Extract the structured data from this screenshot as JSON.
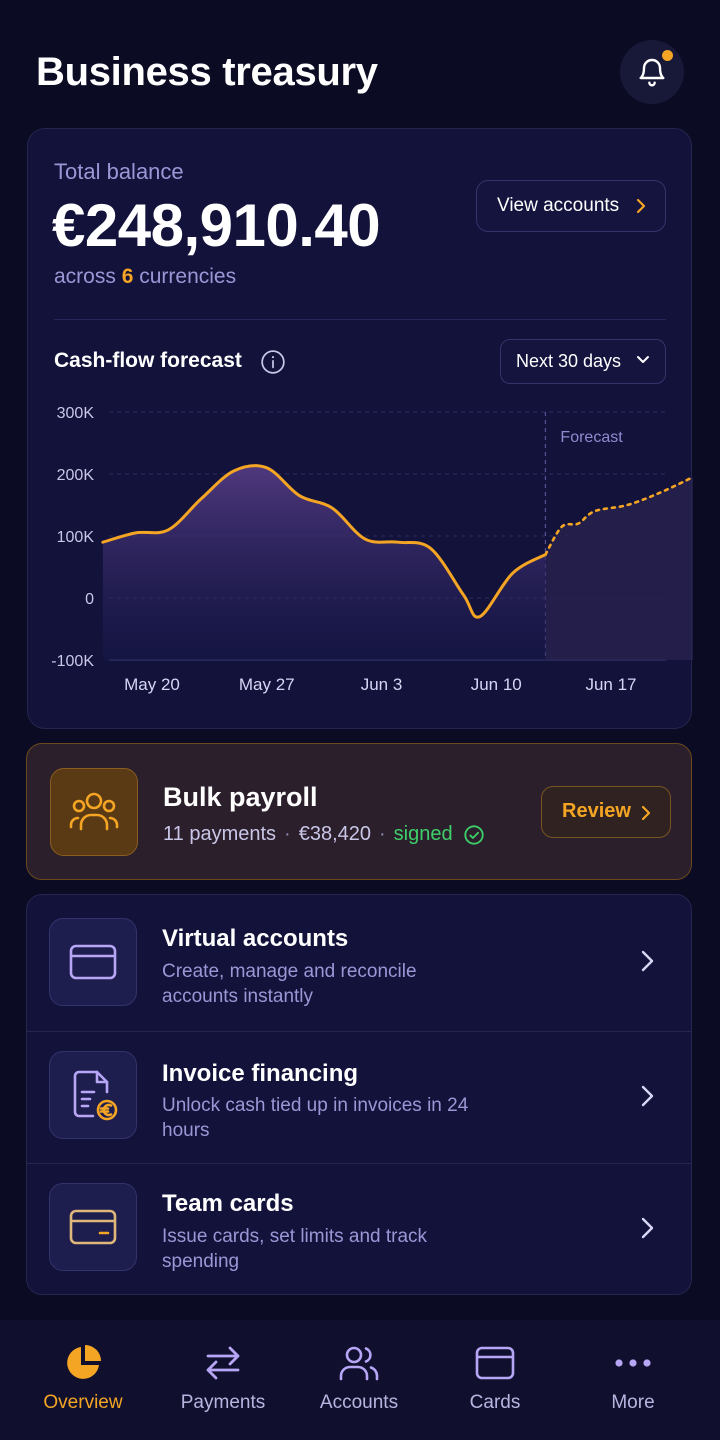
{
  "header": {
    "title": "Business treasury"
  },
  "balance": {
    "label": "Total balance",
    "amount": "€248,910.40",
    "sub_prefix": "across",
    "currency_count": "6",
    "sub_suffix": "currencies",
    "view_accounts_label": "View accounts"
  },
  "forecast": {
    "title": "Cash-flow forecast",
    "range_label": "Next 30 days"
  },
  "chart_data": {
    "type": "line",
    "xlabel": "",
    "ylabel": "",
    "ylim": [
      -100000,
      300000
    ],
    "y_ticks": [
      "300K",
      "200K",
      "100K",
      "0",
      "-100K"
    ],
    "x_ticks": [
      "May 20",
      "May 27",
      "Jun 3",
      "Jun 10",
      "Jun 17"
    ],
    "forecast_label": "Forecast",
    "forecast_start": "Jun 13",
    "grid": true,
    "series": [
      {
        "name": "",
        "points": [
          [
            "May 17",
            90000
          ],
          [
            "May 19",
            105000
          ],
          [
            "May 21",
            110000
          ],
          [
            "May 23",
            160000
          ],
          [
            "May 25",
            205000
          ],
          [
            "May 27",
            210000
          ],
          [
            "May 29",
            165000
          ],
          [
            "May 31",
            145000
          ],
          [
            "Jun 2",
            95000
          ],
          [
            "Jun 4",
            90000
          ],
          [
            "Jun 6",
            80000
          ],
          [
            "Jun 8",
            5000
          ],
          [
            "Jun 9",
            -30000
          ],
          [
            "Jun 11",
            40000
          ],
          [
            "Jun 13",
            70000
          ],
          [
            "Jun 14",
            115000
          ],
          [
            "Jun 15",
            120000
          ],
          [
            "Jun 16",
            140000
          ],
          [
            "Jun 18",
            150000
          ],
          [
            "Jun 20",
            170000
          ],
          [
            "Jun 22",
            195000
          ]
        ]
      }
    ]
  },
  "payroll": {
    "title": "Bulk payroll",
    "payments": "11 payments",
    "amount": "€38,420",
    "status": "signed",
    "review_label": "Review"
  },
  "services": [
    {
      "title": "Virtual accounts",
      "desc": "Create, manage and reconcile accounts instantly"
    },
    {
      "title": "Invoice financing",
      "desc": "Unlock cash tied up in invoices in 24 hours"
    },
    {
      "title": "Team cards",
      "desc": "Issue cards, set limits and track spending"
    }
  ],
  "nav": [
    {
      "label": "Overview",
      "icon": "pie-chart-icon",
      "active": true
    },
    {
      "label": "Payments",
      "icon": "transfer-arrows-icon",
      "active": false
    },
    {
      "label": "Accounts",
      "icon": "users-icon",
      "active": false
    },
    {
      "label": "Cards",
      "icon": "card-icon",
      "active": false
    },
    {
      "label": "More",
      "icon": "more-dots-icon",
      "active": false
    }
  ],
  "colors": {
    "accent": "#f5a524",
    "background": "#0b0b24",
    "card": "#12123a",
    "success": "#3ecf6a",
    "muted_text": "#9b97d6"
  }
}
